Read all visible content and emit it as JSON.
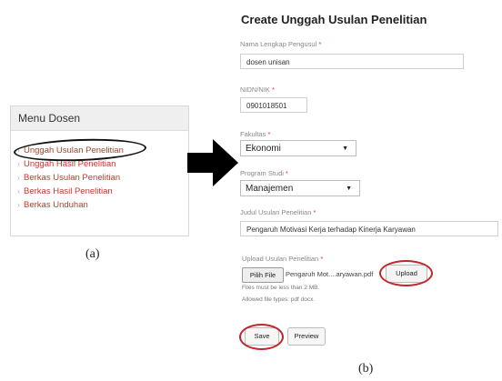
{
  "panel_a": {
    "menu_title": "Menu Dosen",
    "items": [
      {
        "label": "Unggah Usulan Penelitian"
      },
      {
        "label": "Unggah Hasil Penelitian"
      },
      {
        "label": "Berkas Usulan Penelitian"
      },
      {
        "label": "Berkas Hasil Penelitian"
      },
      {
        "label": "Berkas Unduhan"
      }
    ],
    "caption": "(a)"
  },
  "panel_b": {
    "title": "Create Unggah Usulan Penelitian",
    "nama": {
      "label": "Nama Lengkap Pengusul",
      "value": "dosen unisan"
    },
    "nidn": {
      "label": "NIDN/NIK",
      "value": "0901018501"
    },
    "fakultas": {
      "label": "Fakultas",
      "value": "Ekonomi"
    },
    "prodi": {
      "label": "Program Studi",
      "value": "Manajemen"
    },
    "judul": {
      "label": "Judul Usulan Penelitian",
      "value": "Pengaruh Motivasi Kerja terhadap Kinerja Karyawan"
    },
    "upload": {
      "label": "Upload Usulan Penelitian",
      "choose_button": "Pilih File",
      "file_name": "Pengaruh Mot....aryawan.pdf",
      "upload_button": "Upload",
      "hint_size": "Files must be less than 2 MB.",
      "hint_types": "Allowed file types: pdf docx."
    },
    "required_mark": "*",
    "save_button": "Save",
    "preview_button": "Preview",
    "caption": "(b)"
  },
  "colors": {
    "menu_link": "#c0392b",
    "highlight_black": "#111111",
    "highlight_red": "#c0262b"
  }
}
